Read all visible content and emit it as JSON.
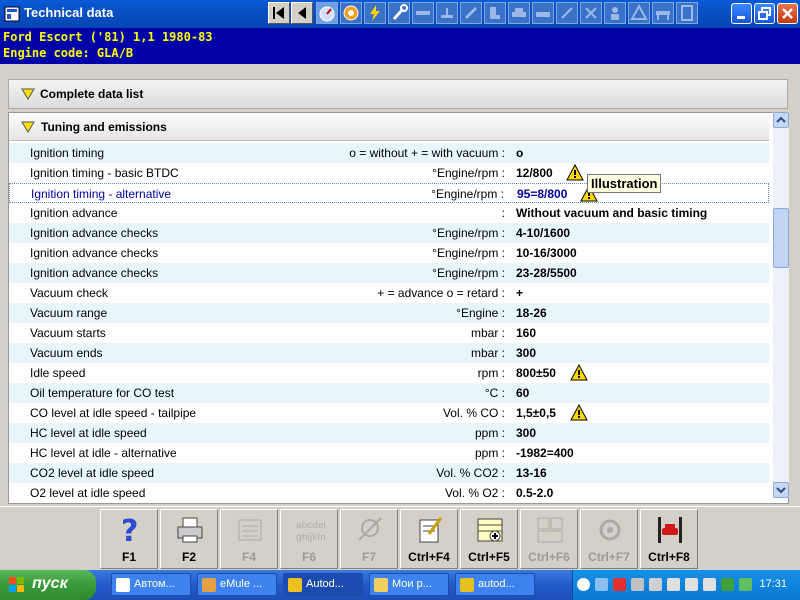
{
  "window": {
    "title": "Technical data"
  },
  "vehicle": {
    "line1": "Ford   Escort ('81) 1,1   1980-83",
    "line2": "Engine code: GLA/B"
  },
  "sections": {
    "complete": "Complete data list",
    "tuning": "Tuning and emissions"
  },
  "tooltip": "Illustration",
  "rows": [
    {
      "name": "Ignition timing",
      "unit": "o = without  + = with vacuum :",
      "value": "o"
    },
    {
      "name": "Ignition timing - basic  BTDC",
      "unit": "°Engine/rpm :",
      "value": "12/800"
    },
    {
      "name": "Ignition timing - alternative",
      "unit": "°Engine/rpm :",
      "value": "95=8/800"
    },
    {
      "name": "Ignition advance",
      "unit": ":",
      "value": "Without vacuum and basic timing"
    },
    {
      "name": "Ignition advance checks",
      "unit": "°Engine/rpm :",
      "value": "4-10/1600"
    },
    {
      "name": "Ignition advance checks",
      "unit": "°Engine/rpm :",
      "value": "10-16/3000"
    },
    {
      "name": "Ignition advance checks",
      "unit": "°Engine/rpm :",
      "value": "23-28/5500"
    },
    {
      "name": "Vacuum check",
      "unit": "+ = advance  o = retard :",
      "value": "+"
    },
    {
      "name": "Vacuum range",
      "unit": "°Engine :",
      "value": "18-26"
    },
    {
      "name": "Vacuum starts",
      "unit": "mbar :",
      "value": "160"
    },
    {
      "name": "Vacuum ends",
      "unit": "mbar :",
      "value": "300"
    },
    {
      "name": "Idle speed",
      "unit": "rpm :",
      "value": "800±50"
    },
    {
      "name": "Oil temperature for CO test",
      "unit": "°C :",
      "value": "60"
    },
    {
      "name": "CO level at idle speed - tailpipe",
      "unit": "Vol. % CO :",
      "value": "1,5±0,5"
    },
    {
      "name": "HC level at idle speed",
      "unit": "ppm :",
      "value": "300"
    },
    {
      "name": "HC level at idle - alternative",
      "unit": "ppm :",
      "value": "-1982=400"
    },
    {
      "name": "CO2 level at idle speed",
      "unit": "Vol. % CO2 :",
      "value": "13-16"
    },
    {
      "name": "O2 level at idle speed",
      "unit": "Vol. % O2 :",
      "value": "0.5-2.0"
    }
  ],
  "fkeys": [
    "F1",
    "F2",
    "F4",
    "F6",
    "F7",
    "Ctrl+F4",
    "Ctrl+F5",
    "Ctrl+F6",
    "Ctrl+F7",
    "Ctrl+F8"
  ],
  "taskbar": {
    "start": "пуск",
    "tasks": [
      "Автом...",
      "eMule ...",
      "Autod...",
      "Мои р...",
      "autod..."
    ],
    "clock": "17:31"
  }
}
